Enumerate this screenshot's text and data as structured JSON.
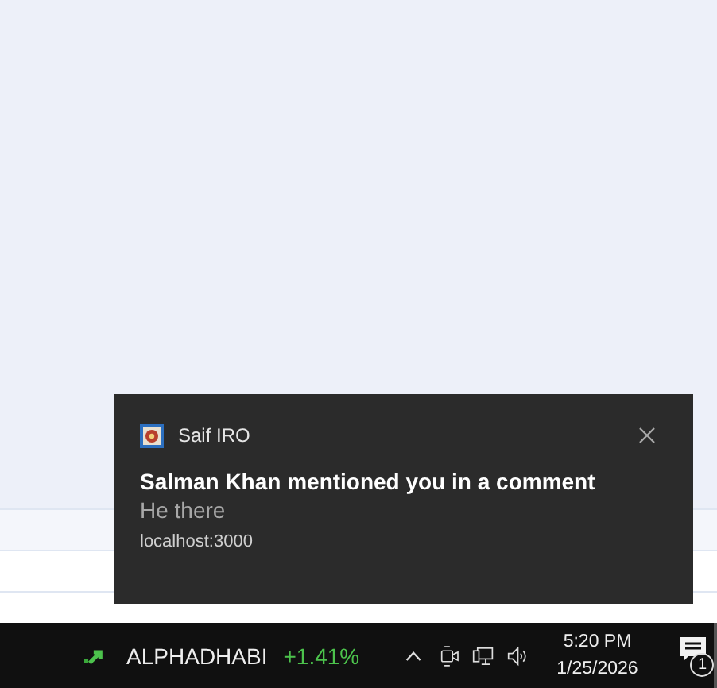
{
  "notification": {
    "app": "Saif IRO",
    "title": "Salman Khan mentioned you in a comment",
    "body": "He there",
    "source": "localhost:3000"
  },
  "taskbar": {
    "ticker": {
      "symbol": "ALPHADHABI",
      "change": "+1.41%"
    },
    "time": "5:20 PM",
    "date": "1/25/2026",
    "notification_count": "1"
  }
}
